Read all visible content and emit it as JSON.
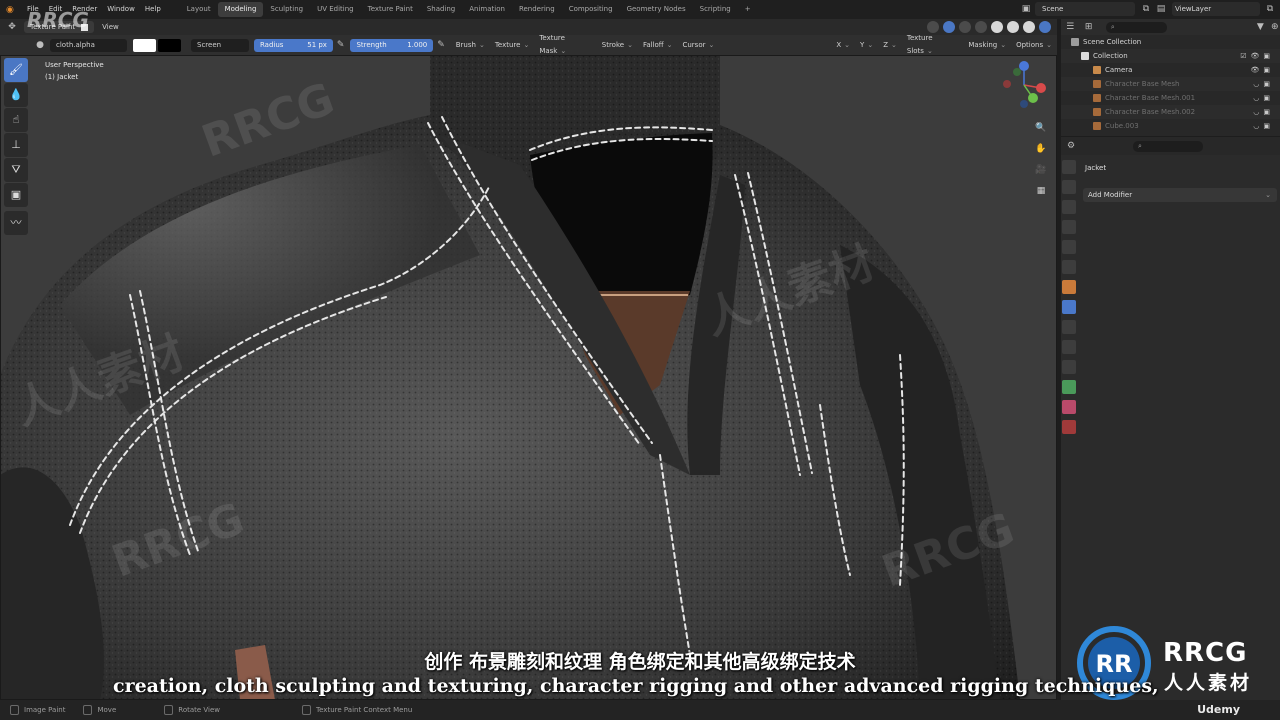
{
  "topbar": {
    "menus": [
      "File",
      "Edit",
      "Render",
      "Window",
      "Help"
    ],
    "workspaces": [
      "Layout",
      "Modeling",
      "Sculpting",
      "UV Editing",
      "Texture Paint",
      "Shading",
      "Animation",
      "Rendering",
      "Compositing",
      "Geometry Nodes",
      "Scripting"
    ],
    "active_workspace": "Modeling",
    "add_tab": "+",
    "scene": "Scene",
    "view_layer": "ViewLayer"
  },
  "viewport_header": {
    "mode": "Texture Paint",
    "view": "View"
  },
  "tool_settings": {
    "texture": "cloth.alpha",
    "blend": "Screen",
    "radius_label": "Radius",
    "radius_value": "51 px",
    "strength_label": "Strength",
    "strength_value": "1.000",
    "menus": [
      "Brush",
      "Texture",
      "Texture Mask",
      "Stroke",
      "Falloff",
      "Cursor"
    ],
    "axes": [
      "X",
      "Y",
      "Z"
    ],
    "texture_slots": "Texture Slots",
    "masking": "Masking",
    "options": "Options",
    "primary_color": "#ffffff",
    "secondary_color": "#000000"
  },
  "viewport": {
    "perspective": "User Perspective",
    "object": "(1) Jacket"
  },
  "outliner": {
    "scene_collection": "Scene Collection",
    "items": [
      {
        "label": "Collection"
      },
      {
        "label": "Camera"
      },
      {
        "label": "Character Base Mesh"
      },
      {
        "label": "Character Base Mesh.001"
      },
      {
        "label": "Character Base Mesh.002"
      },
      {
        "label": "Cube.003"
      }
    ]
  },
  "properties": {
    "object_name": "Jacket",
    "add_modifier": "Add Modifier"
  },
  "subtitles": {
    "chinese": "创作 布景雕刻和纹理 角色绑定和其他高级绑定技术",
    "english": "creation, cloth sculpting and texturing, character rigging and other advanced rigging techniques,"
  },
  "statusbar": {
    "items": [
      "Image Paint",
      "Move",
      "Rotate View",
      "Texture Paint Context Menu"
    ],
    "brand": "Udemy"
  },
  "watermark": {
    "brand": "RRCG",
    "brand_cn": "人人素材"
  }
}
